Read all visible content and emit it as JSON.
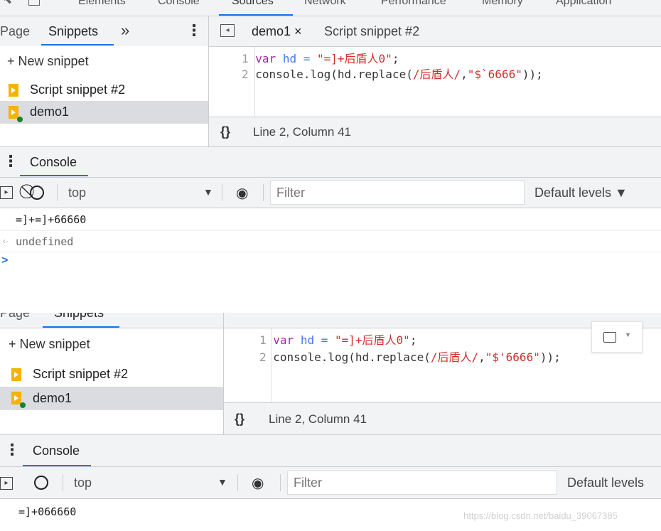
{
  "top_tabs": [
    "Elements",
    "Console",
    "Sources",
    "Network",
    "Performance",
    "Memory",
    "Application"
  ],
  "panel1": {
    "nav_tabs": [
      "Page",
      "Snippets"
    ],
    "more_label": "»",
    "menu_label": "⋮",
    "new_snippet": "+ New snippet",
    "snippets": [
      "Script snippet #2",
      "demo1"
    ],
    "editor_tabs": {
      "active": "demo1 ×",
      "other": "Script snippet #2"
    },
    "code": {
      "line1_num": "1",
      "line2_num": "2",
      "line1_kw": "var",
      "line1_var": "hd",
      "line1_op": " = ",
      "line1_str": "\"=]+后盾人0\"",
      "line1_end": ";",
      "line2_pre": "console.log(hd.replace(",
      "line2_regex": "/后盾人/",
      "line2_comma": ",",
      "line2_str": "\"$`6666\"",
      "line2_end": "));"
    },
    "format_icon": "{}",
    "status": "Line 2, Column 41",
    "console_tab": "Console",
    "context": "top",
    "filter_placeholder": "Filter",
    "levels": "Default levels ▼",
    "output": [
      "=]+=]+66660",
      "undefined"
    ],
    "prompt": ">"
  },
  "panel2": {
    "nav_tabs": [
      "Page",
      "Snippets"
    ],
    "new_snippet": "+ New snippet",
    "snippets": [
      "Script snippet #2",
      "demo1"
    ],
    "code": {
      "line1_num": "1",
      "line2_num": "2",
      "line1_kw": "var",
      "line1_var": "hd",
      "line1_op": " = ",
      "line1_str": "\"=]+后盾人0\"",
      "line1_end": ";",
      "line2_pre": "console.log(hd.replace(",
      "line2_regex": "/后盾人/",
      "line2_comma": ",",
      "line2_str": "\"$'6666\"",
      "line2_end": "));"
    },
    "format_icon": "{}",
    "status": "Line 2, Column 41",
    "console_tab": "Console",
    "context": "top",
    "filter_placeholder": "Filter",
    "levels": "Default levels",
    "output": [
      "=]+066660"
    ]
  },
  "watermark": "https://blog.csdn.net/baidu_39067385"
}
